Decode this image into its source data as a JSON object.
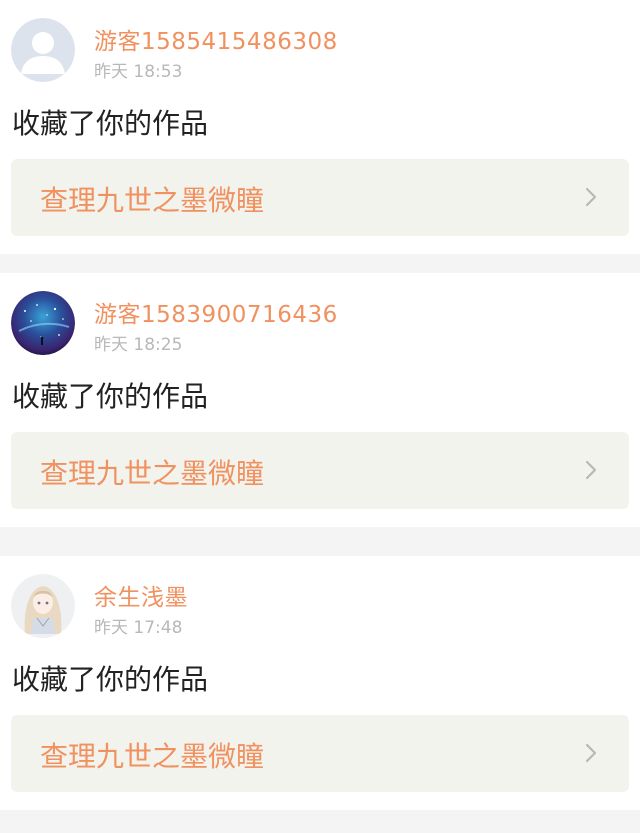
{
  "notifications": [
    {
      "username": "游客1585415486308",
      "time": "昨天 18:53",
      "action": "收藏了你的作品",
      "work_title": "查理九世之墨微瞳",
      "avatar_type": "default-person-icon"
    },
    {
      "username": "游客1583900716436",
      "time": "昨天 18:25",
      "action": "收藏了你的作品",
      "work_title": "查理九世之墨微瞳",
      "avatar_type": "starry-sky-avatar"
    },
    {
      "username": "余生浅墨",
      "time": "昨天 17:48",
      "action": "收藏了你的作品",
      "work_title": "查理九世之墨微瞳",
      "avatar_type": "anime-girl-avatar"
    }
  ],
  "colors": {
    "accent": "#f0915f",
    "timestamp": "#b8b8b8",
    "text": "#222222",
    "link_bg": "#f3f3ee",
    "page_bg": "#f4f4f4"
  },
  "icons": {
    "chevron": "chevron-right-icon"
  }
}
